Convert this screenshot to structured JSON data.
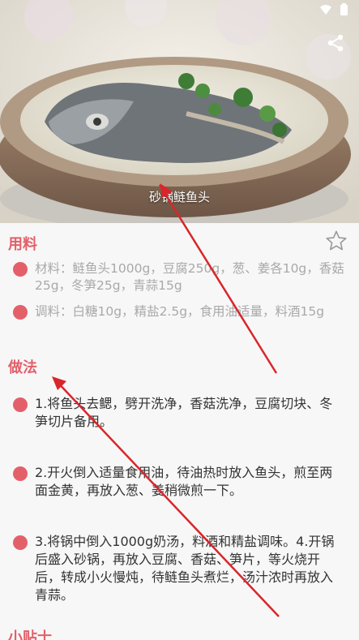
{
  "recipe": {
    "title": "砂锅鲢鱼头"
  },
  "ingredients": {
    "heading": "用料",
    "items": [
      {
        "text": "材料：鲢鱼头1000g，豆腐250g，葱、姜各10g，香菇25g，冬笋25g，青蒜15g"
      },
      {
        "text": "调料：白糖10g，精盐2.5g，食用油适量，料酒15g"
      }
    ]
  },
  "method": {
    "heading": "做法",
    "steps": [
      {
        "text": "1.将鱼头去鳃，劈开洗净，香菇洗净，豆腐切块、冬笋切片备用。"
      },
      {
        "text": "2.开火倒入适量食用油，待油热时放入鱼头，煎至两面金黄，再放入葱、姜稍微煎一下。"
      },
      {
        "text": "3.将锅中倒入1000g奶汤，料酒和精盐调味。4.开锅后盛入砂锅，再放入豆腐、香菇、笋片，等火烧开后，转成小火慢炖，待鲢鱼头煮烂，汤汁浓时再放入青蒜。"
      }
    ]
  },
  "tips": {
    "heading": "小贴士"
  },
  "icons": {
    "share": "share-icon",
    "favorite": "star-outline-icon",
    "wifi": "wifi-icon",
    "battery": "battery-icon"
  },
  "colors": {
    "accent": "#e3606a",
    "annotation_arrow": "#d9262b"
  }
}
